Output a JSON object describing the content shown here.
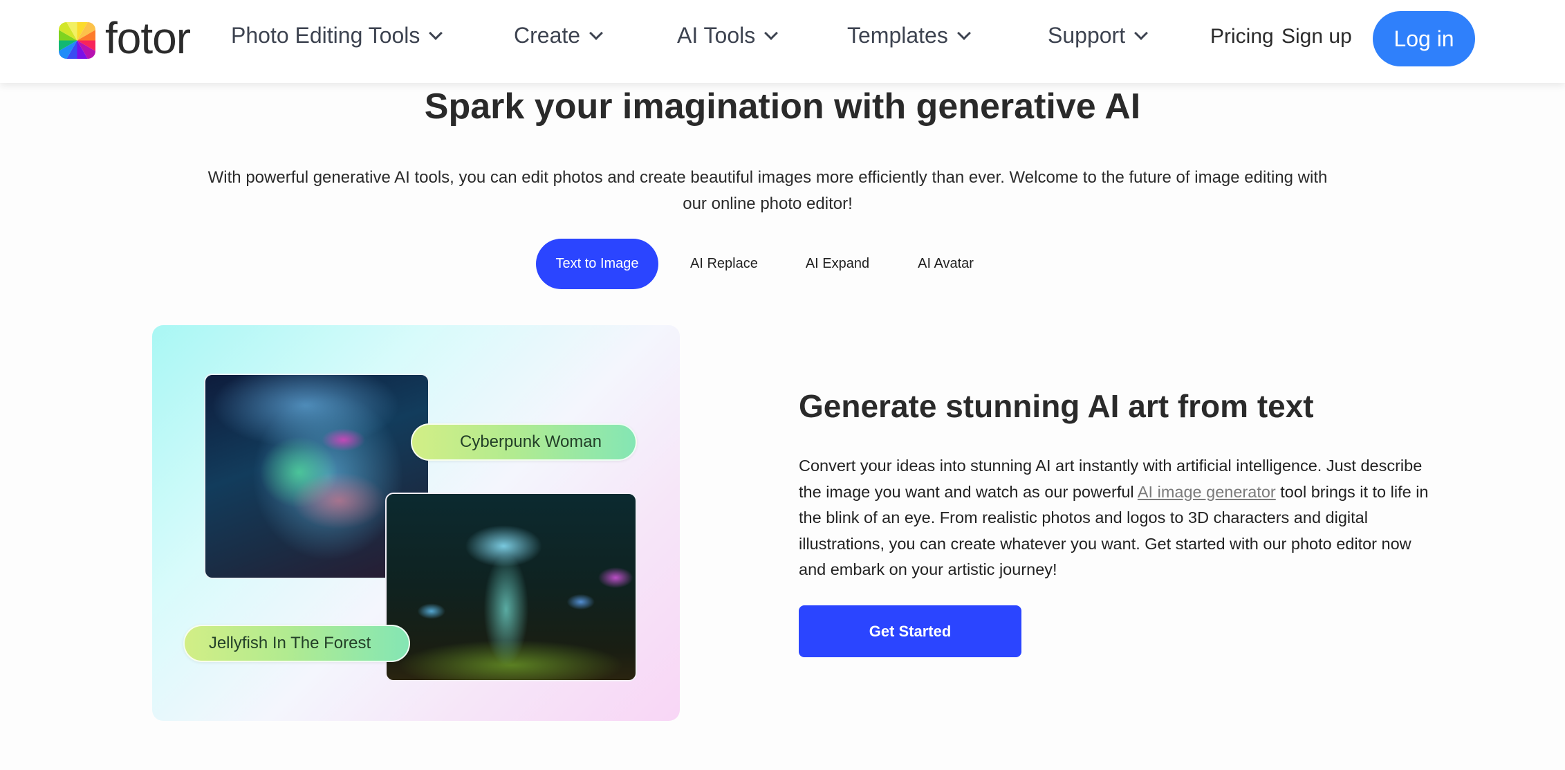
{
  "header": {
    "logo_text": "fotor",
    "nav": [
      {
        "label": "Photo Editing Tools",
        "has_dropdown": true
      },
      {
        "label": "Create",
        "has_dropdown": true
      },
      {
        "label": "AI Tools",
        "has_dropdown": true
      },
      {
        "label": "Templates",
        "has_dropdown": true
      },
      {
        "label": "Support",
        "has_dropdown": true
      }
    ],
    "pricing_label": "Pricing",
    "signup_label": "Sign up",
    "login_label": "Log in",
    "login_color": "#2f80fb"
  },
  "hero": {
    "title": "Spark your imagination with generative AI",
    "subtitle": "With powerful generative AI tools, you can edit photos and create beautiful images more efficiently than ever. Welcome to the future of image editing with our online photo editor!"
  },
  "tabs": {
    "active_color": "#2b45ff",
    "items": [
      {
        "label": "Text to Image",
        "active": true
      },
      {
        "label": "AI Replace",
        "active": false
      },
      {
        "label": "AI Expand",
        "active": false
      },
      {
        "label": "AI Avatar",
        "active": false
      }
    ]
  },
  "showcase": {
    "images": [
      {
        "label": "Cyberpunk Woman",
        "icon": "cyberpunk-woman-image"
      },
      {
        "label": "Jellyfish In The Forest",
        "icon": "jellyfish-forest-image"
      }
    ]
  },
  "feature": {
    "title": "Generate stunning AI art from text",
    "desc_before": "Convert your ideas into stunning AI art instantly with artificial intelligence. Just describe the image you want and watch as our powerful ",
    "desc_link": "AI image generator",
    "desc_after": " tool brings it to life in the blink of an eye. From realistic photos and logos to 3D characters and digital illustrations, you can create whatever you want. Get started with our photo editor now and embark on your artistic journey!",
    "cta_label": "Get Started",
    "cta_color": "#2b45ff"
  }
}
